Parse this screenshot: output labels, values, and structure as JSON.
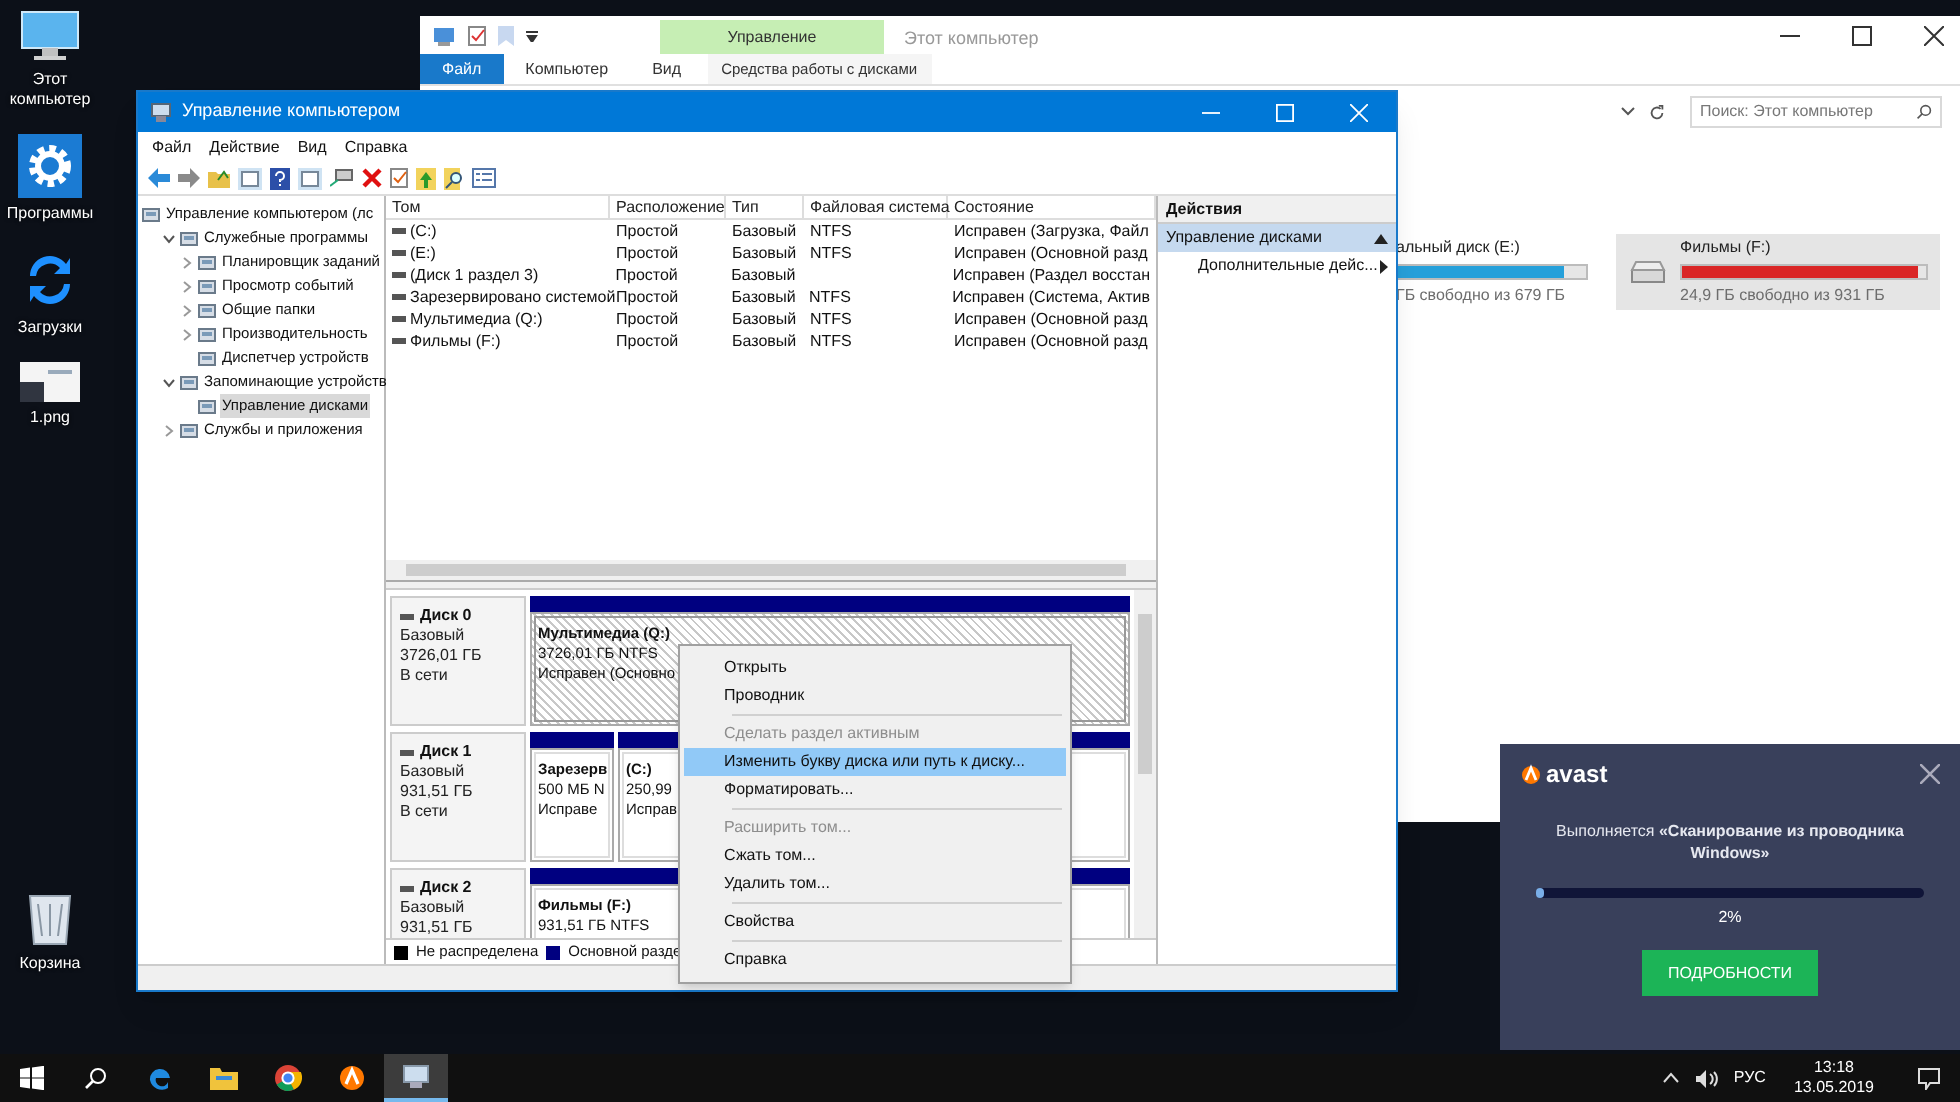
{
  "desktop_icons": [
    {
      "label": "Этот компьютер",
      "kind": "computer"
    },
    {
      "label": "Программы",
      "kind": "gear"
    },
    {
      "label": "Загрузки",
      "kind": "sync"
    },
    {
      "label": "1.png",
      "kind": "image"
    },
    {
      "label": "Корзина",
      "kind": "bin"
    }
  ],
  "explorer": {
    "context_tab": "Управление",
    "title": "Этот компьютер",
    "tabs": [
      {
        "label": "Файл",
        "selected": true
      },
      {
        "label": "Компьютер",
        "selected": false
      },
      {
        "label": "Вид",
        "selected": false
      },
      {
        "label": "Средства работы с дисками",
        "selected": false
      }
    ],
    "search": {
      "placeholder": "Поиск: Этот компьютер"
    },
    "drives": [
      {
        "name": "альный диск (E:)",
        "free": "ГБ свободно из 679 ГБ",
        "level": 0.88,
        "selected": false,
        "color": "#26a0da"
      },
      {
        "name": "Фильмы (F:)",
        "free": "24,9 ГБ свободно из 931 ГБ",
        "level": 0.97,
        "selected": true,
        "color": "#da2626"
      }
    ]
  },
  "management": {
    "title": "Управление компьютером",
    "menu": [
      "Файл",
      "Действие",
      "Вид",
      "Справка"
    ],
    "tree": [
      {
        "label": "Управление компьютером (лс",
        "selected": false,
        "children": [
          {
            "label": "Служебные программы",
            "expanded": true,
            "selected": false,
            "children": [
              {
                "label": "Планировщик заданий",
                "expanded": false,
                "selected": false
              },
              {
                "label": "Просмотр событий",
                "expanded": false,
                "selected": false
              },
              {
                "label": "Общие папки",
                "expanded": false,
                "selected": false
              },
              {
                "label": "Производительность",
                "expanded": false,
                "selected": false
              },
              {
                "label": "Диспетчер устройств",
                "selected": false
              }
            ]
          },
          {
            "label": "Запоминающие устройств",
            "expanded": true,
            "selected": false,
            "children": [
              {
                "label": "Управление дисками",
                "selected": true
              }
            ]
          },
          {
            "label": "Службы и приложения",
            "expanded": false,
            "selected": false
          }
        ]
      }
    ],
    "volumes": {
      "columns": [
        "Том",
        "Расположение",
        "Тип",
        "Файловая система",
        "Состояние"
      ],
      "rows": [
        [
          "(C:)",
          "Простой",
          "Базовый",
          "NTFS",
          "Исправен (Загрузка, Файл"
        ],
        [
          "(E:)",
          "Простой",
          "Базовый",
          "NTFS",
          "Исправен (Основной разд"
        ],
        [
          "(Диск 1 раздел 3)",
          "Простой",
          "Базовый",
          "",
          "Исправен (Раздел восстан"
        ],
        [
          "Зарезервировано системой",
          "Простой",
          "Базовый",
          "NTFS",
          "Исправен (Система, Актив"
        ],
        [
          "Мультимедиа (Q:)",
          "Простой",
          "Базовый",
          "NTFS",
          "Исправен (Основной разд"
        ],
        [
          "Фильмы (F:)",
          "Простой",
          "Базовый",
          "NTFS",
          "Исправен (Основной разд"
        ]
      ]
    },
    "disks": [
      {
        "name": "Диск 0",
        "type": "Базовый",
        "size": "3726,01 ГБ",
        "status": "В сети",
        "partitions": [
          {
            "lines": [
              "Мультимедиа  (Q:)",
              "3726,01 ГБ NTFS",
              "Исправен (Основно"
            ],
            "selected": true
          }
        ]
      },
      {
        "name": "Диск 1",
        "type": "Базовый",
        "size": "931,51 ГБ",
        "status": "В сети",
        "partitions": [
          {
            "lines": [
              "Зарезерв",
              "500 МБ N",
              "Исправе"
            ],
            "selected": false
          },
          {
            "lines": [
              "(C:)",
              "250,99",
              "Исправ"
            ],
            "selected": false
          }
        ]
      },
      {
        "name": "Диск 2",
        "type": "Базовый",
        "size": "931,51 ГБ",
        "partitions": [
          {
            "lines": [
              "Фильмы  (F:)",
              "931,51 ГБ NTFS"
            ],
            "selected": false
          }
        ]
      }
    ],
    "legend": [
      {
        "label": "Не распределена",
        "color": "#000000"
      },
      {
        "label": "Основной разде",
        "color": "#000080"
      }
    ],
    "actions": {
      "title": "Действия",
      "items": [
        {
          "label": "Управление дисками",
          "kind": "section",
          "selected": true
        },
        {
          "label": "Дополнительные дейс...",
          "kind": "submenu",
          "selected": false
        }
      ]
    }
  },
  "context_menu": [
    {
      "kind": "item",
      "label": "Открыть",
      "disabled": false,
      "selected": false
    },
    {
      "kind": "item",
      "label": "Проводник",
      "disabled": false,
      "selected": false
    },
    {
      "kind": "separator"
    },
    {
      "kind": "item",
      "label": "Сделать раздел активным",
      "disabled": true,
      "selected": false
    },
    {
      "kind": "item",
      "label": "Изменить букву диска или путь к диску...",
      "disabled": false,
      "selected": true
    },
    {
      "kind": "item",
      "label": "Форматировать...",
      "disabled": false,
      "selected": false
    },
    {
      "kind": "separator"
    },
    {
      "kind": "item",
      "label": "Расширить том...",
      "disabled": true,
      "selected": false
    },
    {
      "kind": "item",
      "label": "Сжать том...",
      "disabled": false,
      "selected": false
    },
    {
      "kind": "item",
      "label": "Удалить том...",
      "disabled": false,
      "selected": false
    },
    {
      "kind": "separator"
    },
    {
      "kind": "item",
      "label": "Свойства",
      "disabled": false,
      "selected": false
    },
    {
      "kind": "separator"
    },
    {
      "kind": "item",
      "label": "Справка",
      "disabled": false,
      "selected": false
    }
  ],
  "avast": {
    "brand": "avast",
    "message": "Выполняется **«Сканирование из проводника Windows»**",
    "level": 0.02,
    "percent": "2%",
    "button": "ПОДРОБНОСТИ"
  },
  "taskbar": {
    "apps": [
      {
        "kind": "start",
        "selected": false
      },
      {
        "kind": "search",
        "selected": false
      },
      {
        "kind": "edge",
        "selected": false
      },
      {
        "kind": "explorer",
        "selected": false
      },
      {
        "kind": "chrome",
        "selected": false
      },
      {
        "kind": "avast",
        "selected": false
      },
      {
        "kind": "management",
        "selected": true
      }
    ],
    "language": "РУС",
    "time": "13:18",
    "date": "13.05.2019"
  }
}
